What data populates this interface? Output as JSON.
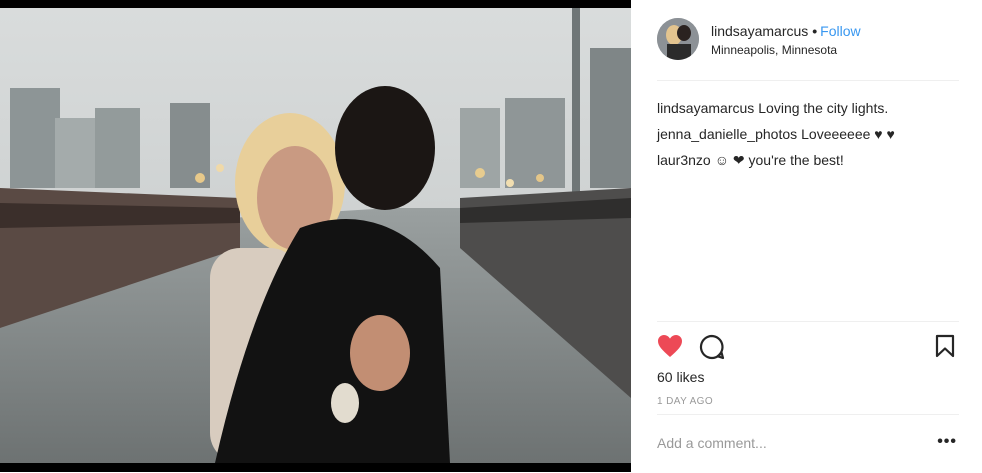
{
  "post": {
    "username": "lindsayamarcus",
    "follow_label": "Follow",
    "separator": "•",
    "location": "Minneapolis, Minnesota"
  },
  "comments": [
    {
      "author": "lindsayamarcus",
      "text": "Loving the city lights."
    },
    {
      "author": "jenna_danielle_photos",
      "text": "Loveeeeee ♥ ♥"
    },
    {
      "author": "laur3nzo",
      "text": "☺ ❤ you're the best!"
    }
  ],
  "engagement": {
    "likes_label": "60 likes",
    "timestamp": "1 DAY AGO",
    "liked": true,
    "like_color": "#ed4956"
  },
  "comment_box": {
    "placeholder": "Add a comment...",
    "more_label": "•••"
  },
  "icons": [
    "heart-icon",
    "comment-icon",
    "bookmark-icon",
    "more-options-icon"
  ]
}
